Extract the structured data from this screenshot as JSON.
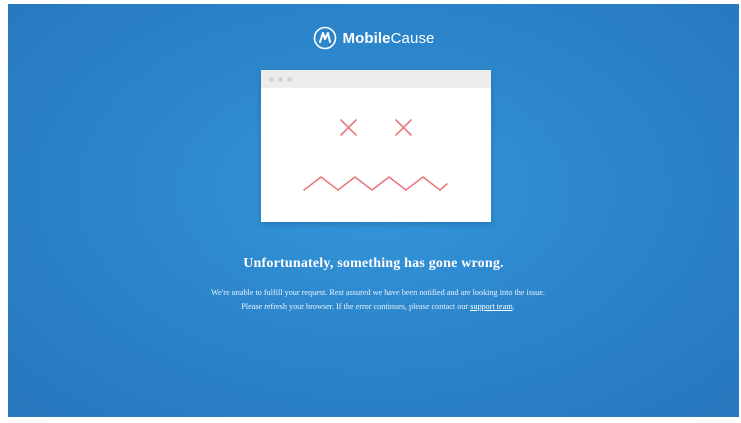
{
  "brand": {
    "name_bold": "Mobile",
    "name_light": "Cause"
  },
  "error": {
    "headline": "Unfortunately, something has gone wrong.",
    "message_before": "We're unable to fulfill your request. Rest assured we have been notified and are looking into the issue. Please refresh your browser. If the error continues, please contact our ",
    "support_link": "support team",
    "message_after": "."
  },
  "colors": {
    "background": "#2c86cc",
    "face_stroke": "#e8797d",
    "text": "#ffffff"
  },
  "icons": {
    "logo": "mobilecause-logo-icon",
    "illustration": "broken-browser-face-icon"
  }
}
